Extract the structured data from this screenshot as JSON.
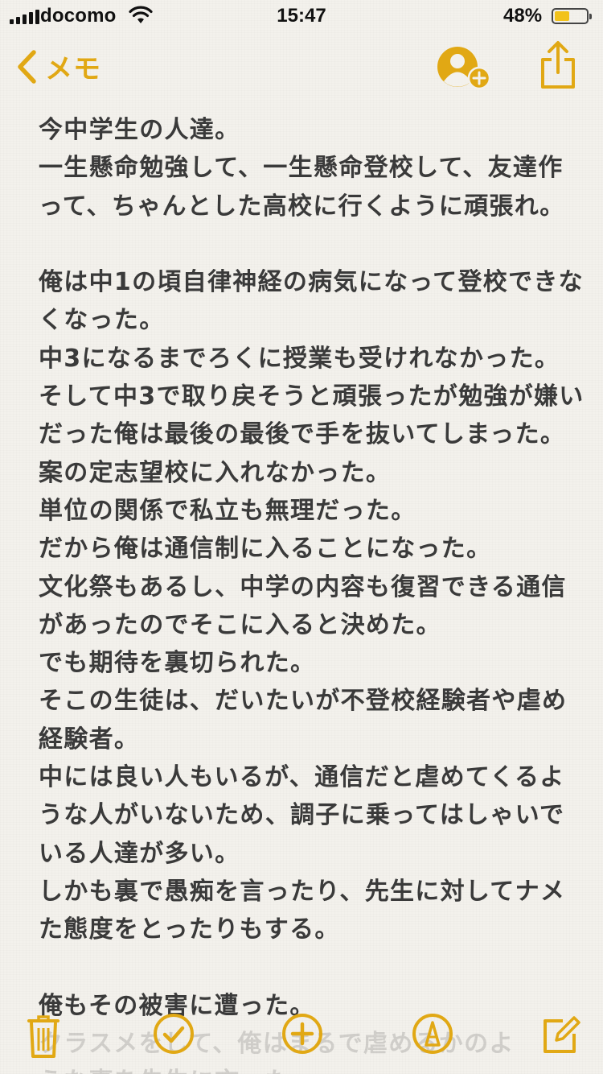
{
  "status_bar": {
    "carrier": "docomo",
    "time": "15:47",
    "battery_percent": "48%",
    "battery_level": 0.48
  },
  "nav": {
    "back_label": "メモ",
    "icons": [
      "chevron-left-icon",
      "add-person-icon",
      "share-icon"
    ]
  },
  "note": {
    "lines": [
      "今中学生の人達。",
      "一生懸命勉強して、一生懸命登校して、友達作",
      "って、ちゃんとした高校に行くように頑張れ。",
      "",
      "俺は中1の頃自律神経の病気になって登校できな",
      "くなった。",
      "中3になるまでろくに授業も受けれなかった。",
      "そして中3で取り戻そうと頑張ったが勉強が嫌い",
      "だった俺は最後の最後で手を抜いてしまった。",
      "案の定志望校に入れなかった。",
      "単位の関係で私立も無理だった。",
      "だから俺は通信制に入ることになった。",
      "文化祭もあるし、中学の内容も復習できる通信",
      "があったのでそこに入ると決めた。",
      "でも期待を裏切られた。",
      "そこの生徒は、だいたいが不登校経験者や虐め",
      "経験者。",
      "中には良い人もいるが、通信だと虐めてくるよ",
      "うな人がいないため、調子に乗ってはしゃいで",
      "いる人達が多い。",
      "しかも裏で愚痴を言ったり、先生に対してナメ",
      "た態度をとったりもする。",
      "",
      "俺もその被害に遭った。"
    ],
    "faded_lines": [
      "クラスメをして、俺はまるで虐めるかのよ",
      "うな事を先生に言った。"
    ]
  },
  "toolbar": {
    "icons": [
      "trash-icon",
      "checklist-icon",
      "add-icon",
      "markup-icon",
      "compose-icon"
    ]
  },
  "colors": {
    "accent": "#e1a814",
    "text": "#3a3a3a",
    "background": "#f3f1ec"
  }
}
